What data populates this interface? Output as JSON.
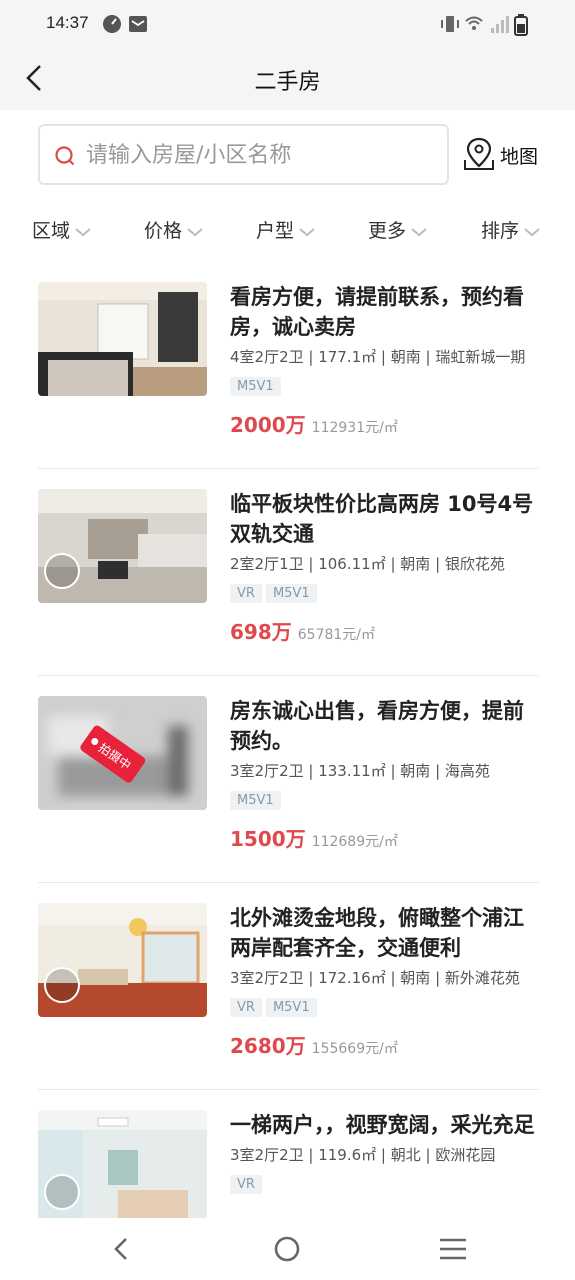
{
  "status": {
    "time": "14:37"
  },
  "header": {
    "title": "二手房"
  },
  "search": {
    "placeholder": "请输入房屋/小区名称",
    "map_label": "地图"
  },
  "filters": [
    "区域",
    "价格",
    "户型",
    "更多",
    "排序"
  ],
  "listings": [
    {
      "title": "看房方便，请提前联系，预约看房，诚心卖房",
      "meta": "4室2厅2卫 | 177.1㎡ | 朝南 | 瑞虹新城一期",
      "tags": [
        "M5V1"
      ],
      "price": "2000万",
      "unit_price": "112931元/㎡",
      "vr": false
    },
    {
      "title": "临平板块性价比高两房 10号4号双轨交通",
      "meta": "2室2厅1卫 | 106.11㎡ | 朝南 | 银欣花苑",
      "tags": [
        "VR",
        "M5V1"
      ],
      "price": "698万",
      "unit_price": "65781元/㎡",
      "vr": true
    },
    {
      "title": "房东诚心出售，看房方便，提前预约。",
      "meta": "3室2厅2卫 | 133.11㎡ | 朝南 | 海高苑",
      "tags": [
        "M5V1"
      ],
      "price": "1500万",
      "unit_price": "112689元/㎡",
      "vr": false,
      "stamp": "拍摄中"
    },
    {
      "title": "北外滩烫金地段，俯瞰整个浦江两岸配套齐全，交通便利",
      "meta": "3室2厅2卫 | 172.16㎡ | 朝南 | 新外滩花苑",
      "tags": [
        "VR",
        "M5V1"
      ],
      "price": "2680万",
      "unit_price": "155669元/㎡",
      "vr": true
    },
    {
      "title": "一梯两户，，视野宽阔，采光充足",
      "meta": "3室2厅2卫 | 119.6㎡ | 朝北 | 欧洲花园",
      "tags": [
        "VR"
      ],
      "price": "",
      "unit_price": "",
      "vr": true
    }
  ],
  "colors": {
    "price": "#e0484e",
    "tag_bg": "#eef2f5",
    "tag_text": "#8a98a6"
  }
}
